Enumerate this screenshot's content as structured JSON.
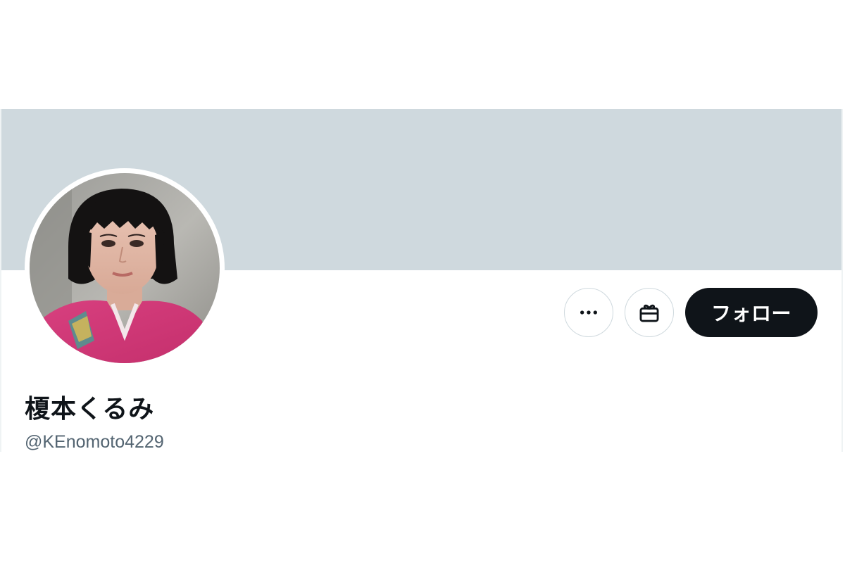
{
  "profile": {
    "display_name": "榎本くるみ",
    "handle": "@KEnomoto4229",
    "avatar_alt": "avatar"
  },
  "actions": {
    "more_icon": "more-horizontal-icon",
    "gift_icon": "gift-icon",
    "follow_label": "フォロー"
  },
  "colors": {
    "banner": "#cfd9de",
    "follow_bg": "#0f1419",
    "follow_text": "#ffffff",
    "handle_text": "#536471",
    "name_text": "#0f1419"
  }
}
